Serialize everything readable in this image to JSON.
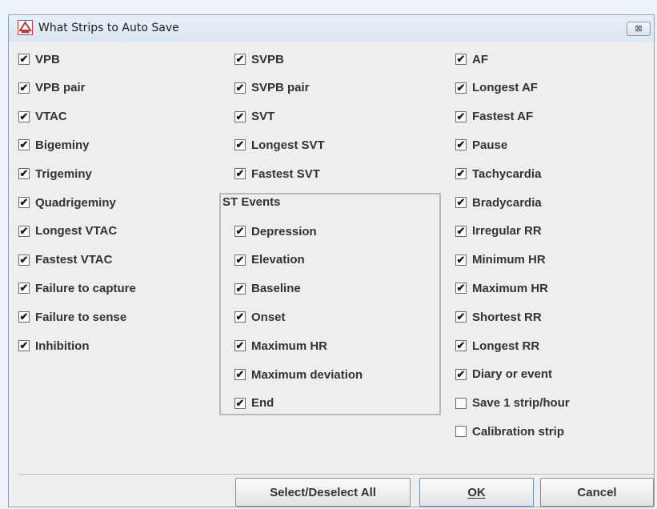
{
  "window": {
    "title": "What Strips to Auto Save",
    "close_glyph": "⊠",
    "icon": "app-logo-icon"
  },
  "check_glyph": "✔",
  "column1": [
    {
      "label": "VPB",
      "checked": true
    },
    {
      "label": "VPB pair",
      "checked": true
    },
    {
      "label": "VTAC",
      "checked": true
    },
    {
      "label": "Bigeminy",
      "checked": true
    },
    {
      "label": "Trigeminy",
      "checked": true
    },
    {
      "label": "Quadrigeminy",
      "checked": true
    },
    {
      "label": "Longest VTAC",
      "checked": true
    },
    {
      "label": "Fastest VTAC",
      "checked": true
    },
    {
      "label": "Failure to capture",
      "checked": true
    },
    {
      "label": "Failure to sense",
      "checked": true
    },
    {
      "label": "Inhibition",
      "checked": true
    }
  ],
  "column2": [
    {
      "label": "SVPB",
      "checked": true
    },
    {
      "label": "SVPB pair",
      "checked": true
    },
    {
      "label": "SVT",
      "checked": true
    },
    {
      "label": "Longest SVT",
      "checked": true
    },
    {
      "label": "Fastest SVT",
      "checked": true
    }
  ],
  "st_events": {
    "title": "ST Events",
    "items": [
      {
        "label": "Depression",
        "checked": true
      },
      {
        "label": "Elevation",
        "checked": true
      },
      {
        "label": "Baseline",
        "checked": true
      },
      {
        "label": "Onset",
        "checked": true
      },
      {
        "label": "Maximum HR",
        "checked": true
      },
      {
        "label": "Maximum deviation",
        "checked": true
      },
      {
        "label": "End",
        "checked": true
      }
    ]
  },
  "column3": [
    {
      "label": "AF",
      "checked": true
    },
    {
      "label": "Longest AF",
      "checked": true
    },
    {
      "label": "Fastest AF",
      "checked": true
    },
    {
      "label": "Pause",
      "checked": true
    },
    {
      "label": "Tachycardia",
      "checked": true
    },
    {
      "label": "Bradycardia",
      "checked": true
    },
    {
      "label": "Irregular RR",
      "checked": true
    },
    {
      "label": "Minimum HR",
      "checked": true
    },
    {
      "label": "Maximum HR",
      "checked": true
    },
    {
      "label": "Shortest RR",
      "checked": true
    },
    {
      "label": "Longest RR",
      "checked": true
    },
    {
      "label": "Diary or event",
      "checked": true
    },
    {
      "label": "Save 1 strip/hour",
      "checked": false
    },
    {
      "label": "Calibration strip",
      "checked": false
    }
  ],
  "buttons": {
    "select_all": "Select/Deselect All",
    "ok": "OK",
    "cancel": "Cancel"
  }
}
